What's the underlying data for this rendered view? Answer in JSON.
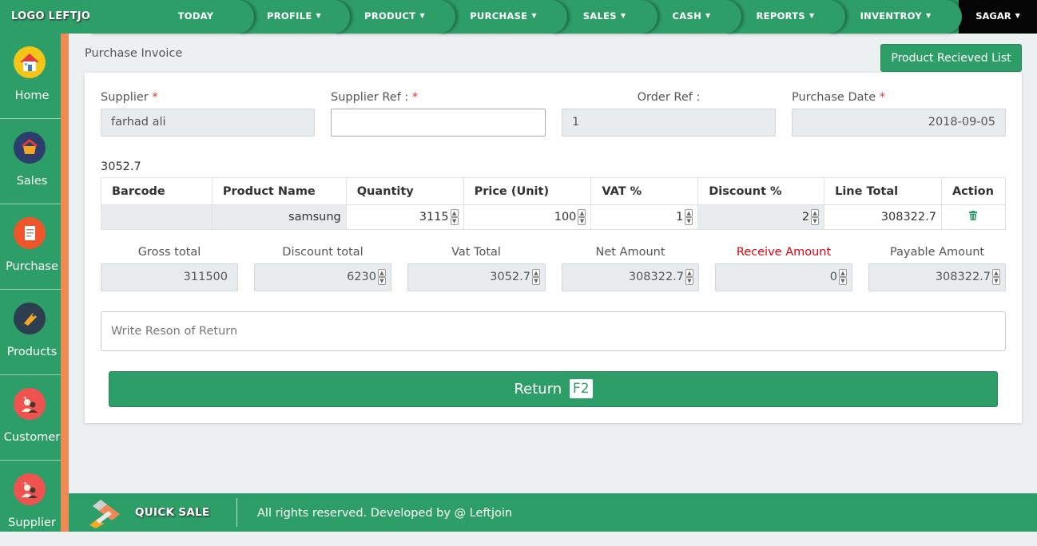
{
  "nav": {
    "logo": "LOGO LEFTJOIN",
    "items": [
      {
        "label": "TODAY",
        "caret": false
      },
      {
        "label": "PROFILE",
        "caret": true
      },
      {
        "label": "PRODUCT",
        "caret": true
      },
      {
        "label": "PURCHASE",
        "caret": true
      },
      {
        "label": "SALES",
        "caret": true
      },
      {
        "label": "CASH",
        "caret": true
      },
      {
        "label": "REPORTS",
        "caret": true
      },
      {
        "label": "INVENTROY",
        "caret": true
      }
    ],
    "user": "SAGAR"
  },
  "sidebar": {
    "items": [
      {
        "label": "Home",
        "icon": "home-icon"
      },
      {
        "label": "Sales",
        "icon": "sales-icon"
      },
      {
        "label": "Purchase",
        "icon": "purchase-icon"
      },
      {
        "label": "Products",
        "icon": "tag-icon"
      },
      {
        "label": "Customer",
        "icon": "customer-icon"
      },
      {
        "label": "Supplier",
        "icon": "supplier-icon"
      }
    ]
  },
  "page": {
    "title": "Purchase Invoice",
    "received_list_button": "Product Recieved List"
  },
  "form": {
    "supplier_label": "Supplier",
    "supplier_value": "farhad ali",
    "supplier_ref_label": "Supplier Ref :",
    "supplier_ref_value": "",
    "order_ref_label": "Order Ref :",
    "order_ref_value": "1",
    "purchase_date_label": "Purchase Date",
    "purchase_date_value": "2018-09-05",
    "required_mark": "*"
  },
  "vat_display": "3052.7",
  "table": {
    "headers": [
      "Barcode",
      "Product Name",
      "Quantity",
      "Price (Unit)",
      "VAT %",
      "Discount %",
      "Line Total",
      "Action"
    ],
    "rows": [
      {
        "barcode": "",
        "product_name": "samsung",
        "quantity": "3115",
        "price": "100",
        "vat": "1",
        "discount": "2",
        "line_total": "308322.7"
      }
    ]
  },
  "totals": {
    "gross_label": "Gross total",
    "gross_value": "311500",
    "discount_label": "Discount total",
    "discount_value": "6230",
    "vat_label": "Vat Total",
    "vat_value": "3052.7",
    "net_label": "Net Amount",
    "net_value": "308322.7",
    "receive_label": "Receive Amount",
    "receive_value": "0",
    "payable_label": "Payable Amount",
    "payable_value": "308322.7"
  },
  "reason_placeholder": "Write Reson of Return",
  "return_button": {
    "label": "Return",
    "shortcut": "F2"
  },
  "footer": {
    "quick_sale": "QUICK SALE",
    "copyright": "All rights reserved. Developed by @ Leftjoin"
  },
  "colors": {
    "primary": "#2e9e68",
    "accent": "#f08a55",
    "danger": "#e3000f"
  }
}
